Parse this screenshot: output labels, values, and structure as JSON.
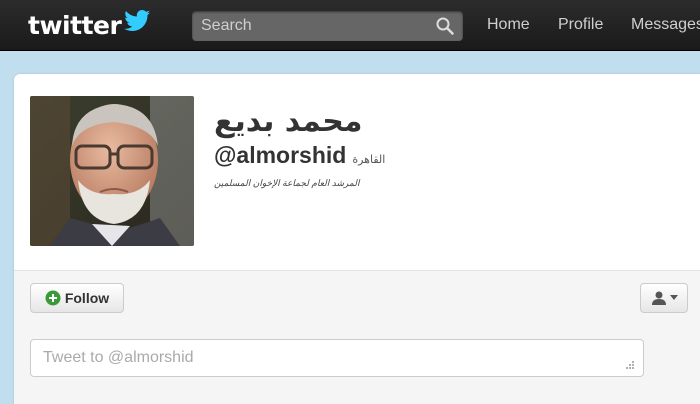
{
  "header": {
    "logo_text": "twitter",
    "search_placeholder": "Search",
    "nav": [
      {
        "label": "Home"
      },
      {
        "label": "Profile"
      },
      {
        "label": "Messages"
      }
    ]
  },
  "profile": {
    "fullname": "محمد بديع",
    "screen_name": "@almorshid",
    "location": "القاهرة",
    "bio": "المرشد العام لجماعة الإخوان المسلمين"
  },
  "actions": {
    "follow_label": "Follow"
  },
  "compose": {
    "placeholder": "Tweet to @almorshid"
  },
  "colors": {
    "topbar": "#1f1f1f",
    "background": "#c0deed",
    "brand_blue": "#33ccff",
    "follow_green": "#3a9a3a"
  },
  "icons": [
    "twitter-bird-icon",
    "search-icon",
    "follow-plus-icon",
    "user-icon",
    "caret-down-icon",
    "resize-grip-icon"
  ]
}
